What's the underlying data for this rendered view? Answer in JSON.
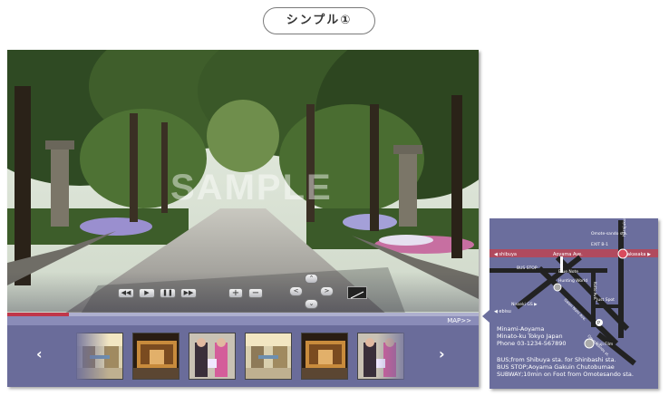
{
  "header": {
    "title": "シンプル①"
  },
  "viewer": {
    "watermark": "SAMPLE",
    "controls": {
      "rewind": "◀◀",
      "play": "▶",
      "pause": "❚❚",
      "fast_forward": "▶▶",
      "zoom_in": "+",
      "zoom_out": "−",
      "pan_up": "⌃",
      "pan_left": "<",
      "pan_right": ">",
      "pan_down": "⌄"
    },
    "progress_fraction": 0.13,
    "map_link": "MAP>>"
  },
  "thumbnails": {
    "prev": "‹",
    "next": "›",
    "items": [
      {
        "scene": "mall-interior"
      },
      {
        "scene": "shop-front"
      },
      {
        "scene": "two-women"
      },
      {
        "scene": "mall-interior"
      },
      {
        "scene": "shop-front"
      },
      {
        "scene": "two-women"
      }
    ]
  },
  "map": {
    "labels": {
      "shibuya": "◀ shibuya",
      "aoyama": "Aoyama Ave.",
      "akasaka": "akasaka ▶",
      "harajuku": "harajuku",
      "omotesando_sta": "Omote-sando sta.",
      "exit": "EXIT B-1",
      "bus_stop": "BUS STOP",
      "blue_note": "Blue Note",
      "hunting_world": "Hunting World",
      "just_spot": "Just Spot",
      "nisseki": "Nisseki GS ▶",
      "ebisu": "◀ ebisu",
      "fuji_film": "Fuji Film",
      "gaien": "Gaien Nishi Ave.",
      "kotto": "Kotto Ave.",
      "omotesando_st": "Omotesando st.",
      "p": "P"
    },
    "address": [
      "Minami-Aoyama",
      "Minato-ku Tokyo Japan",
      "Phone 03-1234-567890"
    ],
    "access": [
      "BUS;from Shibuya sta. for Shinbashi sta.",
      "BUS STOP;Aoyama Gakuin Chutobumae",
      "SUBWAY;10min on Foot from Omotesando sta."
    ]
  },
  "colors": {
    "panel": "#6b6e9d",
    "accent": "#c0374a",
    "road": "#222222",
    "main_road": "#b04a5e"
  }
}
